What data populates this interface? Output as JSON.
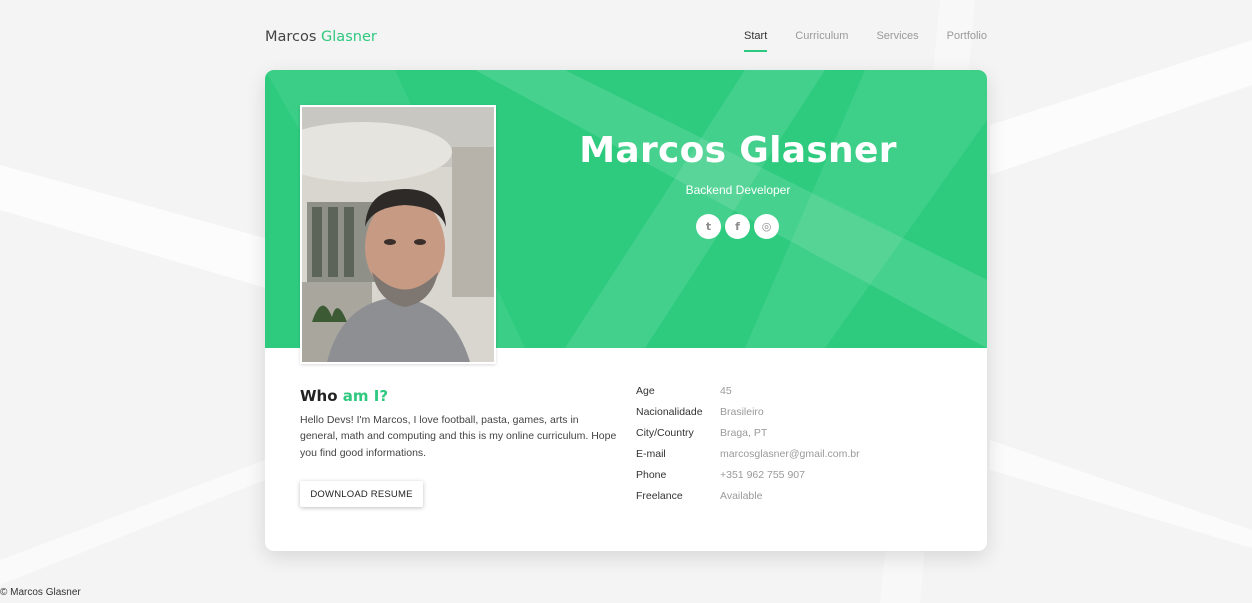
{
  "brand": {
    "first": "Marcos",
    "last": "Glasner"
  },
  "nav": [
    {
      "label": "Start",
      "active": true
    },
    {
      "label": "Curriculum",
      "active": false
    },
    {
      "label": "Services",
      "active": false
    },
    {
      "label": "Portfolio",
      "active": false
    }
  ],
  "hero": {
    "name": "Marcos Glasner",
    "role": "Backend Developer",
    "socials": [
      {
        "icon": "twitter-icon",
        "glyph": "t"
      },
      {
        "icon": "facebook-icon",
        "glyph": "f"
      },
      {
        "icon": "instagram-icon",
        "glyph": "◎"
      }
    ]
  },
  "about": {
    "heading_start": "Who",
    "heading_accent": "am I?",
    "text": "Hello Devs! I'm Marcos, I love football, pasta, games, arts in general, math and computing and this is my online curriculum. Hope you find good informations.",
    "button_label": "DOWNLOAD RESUME"
  },
  "info": [
    {
      "label": "Age",
      "value": "45"
    },
    {
      "label": "Nacionalidade",
      "value": "Brasileiro"
    },
    {
      "label": "City/Country",
      "value": "Braga, PT"
    },
    {
      "label": "E-mail",
      "value": "marcosglasner@gmail.com.br"
    },
    {
      "label": "Phone",
      "value": "+351 962 755 907"
    },
    {
      "label": "Freelance",
      "value": "Available"
    }
  ],
  "footer": "© Marcos Glasner",
  "colors": {
    "accent": "#2ec97e",
    "hero": "#2ecb7f",
    "background": "#f4f4f4"
  }
}
